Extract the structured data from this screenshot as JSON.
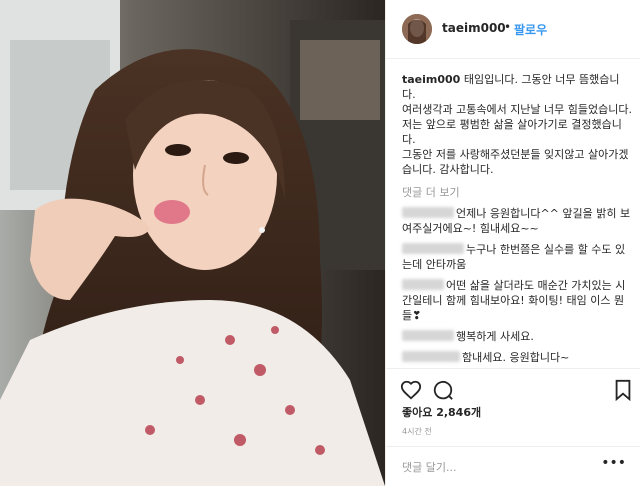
{
  "post": {
    "username": "taeim000",
    "follow_label": "팔로우",
    "separator": "•",
    "caption_user": "taeim000",
    "caption_text": "태임입니다. 그동안 너무 뜸했습니다.\n여러생각과 고통속에서 지난날 너무 힘들었습니다.\n저는 앞으로 평범한 삶을 살아가기로 결정했습니다.\n그동안 저를 사랑해주셨던분들 잊지않고 살아가겠습니다. 감사합니다.",
    "view_more": "댓글 더 보기",
    "comments": [
      {
        "text": "언제나 응원합니다^^ 앞길을 밝히 보여주실거에요~! 힘내세요~~"
      },
      {
        "text": "누구나 한번쯤은 실수를 할 수도 있는데 안타까움"
      },
      {
        "text": "어떤 삶을 살더라도 매순간 가치있는 시간일테니 함께 힘내보아요! 화이팅! 태임 이스 뭔들❣"
      },
      {
        "text": "행복하게 사세요."
      },
      {
        "text": "함내세요. 응원합니다~"
      }
    ],
    "likes": "좋아요 2,846개",
    "time": "4시간 전",
    "add_comment_placeholder": "댓글 달기...",
    "more_icon": "•••"
  },
  "icons": [
    "heart-icon",
    "comment-icon",
    "bookmark-icon",
    "more-options-icon"
  ]
}
